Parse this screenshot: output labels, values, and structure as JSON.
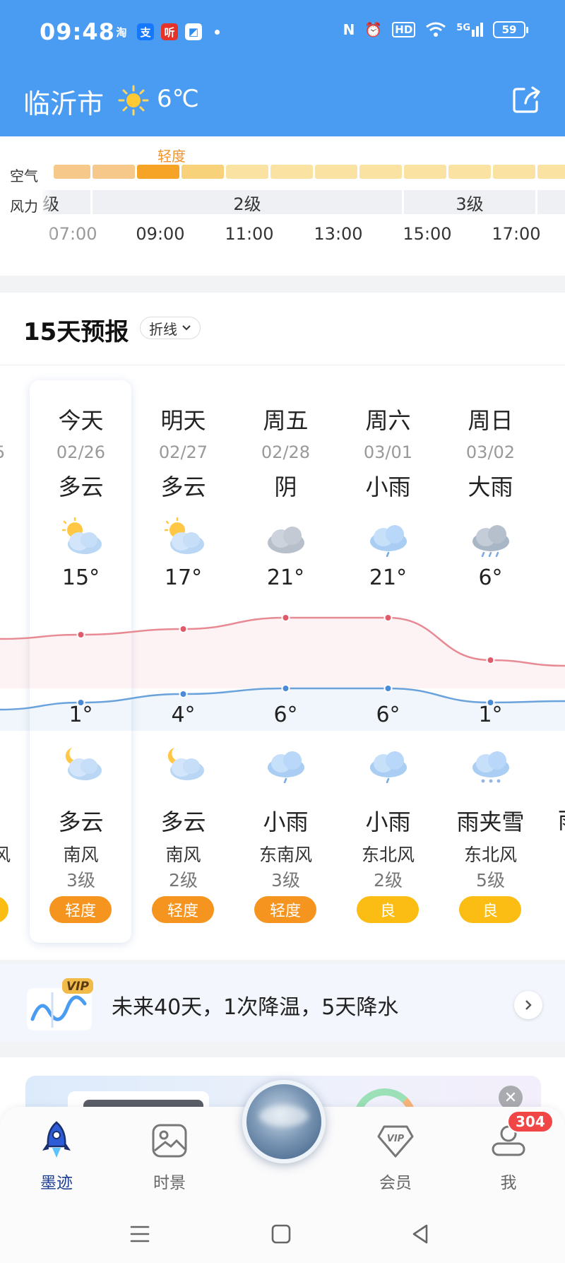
{
  "status_bar": {
    "time": "09:48",
    "app_icons": [
      {
        "name": "taobao-icon",
        "glyph": "淘",
        "bg": "#4a9bf2"
      },
      {
        "name": "alipay-icon",
        "glyph": "支",
        "bg": "#1677ff"
      },
      {
        "name": "ting-icon",
        "glyph": "听",
        "bg": "#e5332a"
      },
      {
        "name": "app-square-icon",
        "glyph": "◩",
        "bg": "#2d8cf0"
      }
    ],
    "nfc": "N",
    "alarm": "⏰",
    "hd": "HD",
    "signal": "5G",
    "battery": "59"
  },
  "header": {
    "city": "临沂市",
    "current_temp": "6℃",
    "weather_icon": "sun-icon"
  },
  "hourly": {
    "aq_label": "空气",
    "wind_label": "风力",
    "aq_highlight": "轻度",
    "wind_segments": [
      "级",
      "2级",
      "3级"
    ],
    "hours": [
      "07:00",
      "09:00",
      "11:00",
      "13:00",
      "15:00",
      "17:00"
    ],
    "colors": {
      "aq_light": "#f7d27a",
      "aq_peach": "#f6c98a",
      "aq_active": "#f5a425",
      "wind_bg": "#eef0f3"
    }
  },
  "forecast": {
    "title": "15天预报",
    "mode": "折线",
    "prev_partial": {
      "date_tail": "5",
      "wind_tail": "风"
    },
    "next_partial": {
      "weather_night": "雨"
    },
    "days": [
      {
        "day": "今天",
        "date": "02/26",
        "weather_day": "多云",
        "icon_day": "partly-cloudy-day-icon",
        "high": "15°",
        "low": "1°",
        "icon_night": "partly-cloudy-night-icon",
        "weather_night": "多云",
        "wind_dir": "南风",
        "wind_level": "3级",
        "aqi": "轻度",
        "aqi_color": "#f5941f",
        "high_val": 15,
        "low_val": 1
      },
      {
        "day": "明天",
        "date": "02/27",
        "weather_day": "多云",
        "icon_day": "partly-cloudy-day-icon",
        "high": "17°",
        "low": "4°",
        "icon_night": "partly-cloudy-night-icon",
        "weather_night": "多云",
        "wind_dir": "南风",
        "wind_level": "2级",
        "aqi": "轻度",
        "aqi_color": "#f5941f",
        "high_val": 17,
        "low_val": 4
      },
      {
        "day": "周五",
        "date": "02/28",
        "weather_day": "阴",
        "icon_day": "overcast-icon",
        "high": "21°",
        "low": "6°",
        "icon_night": "light-rain-icon",
        "weather_night": "小雨",
        "wind_dir": "东南风",
        "wind_level": "3级",
        "aqi": "轻度",
        "aqi_color": "#f5941f",
        "high_val": 21,
        "low_val": 6
      },
      {
        "day": "周六",
        "date": "03/01",
        "weather_day": "小雨",
        "icon_day": "light-rain-icon",
        "high": "21°",
        "low": "6°",
        "icon_night": "light-rain-icon",
        "weather_night": "小雨",
        "wind_dir": "东北风",
        "wind_level": "2级",
        "aqi": "良",
        "aqi_color": "#fbbd13",
        "high_val": 21,
        "low_val": 6
      },
      {
        "day": "周日",
        "date": "03/02",
        "weather_day": "大雨",
        "icon_day": "heavy-rain-icon",
        "high": "6°",
        "low": "1°",
        "icon_night": "sleet-icon",
        "weather_night": "雨夹雪",
        "wind_dir": "东北风",
        "wind_level": "5级",
        "aqi": "良",
        "aqi_color": "#fbbd13",
        "high_val": 6,
        "low_val": 1
      }
    ],
    "colors": {
      "high_line": "#e88a93",
      "low_line": "#6aa3dc",
      "high_dot": "#e05a6a",
      "low_dot": "#4a8ad6"
    }
  },
  "vip_bar": {
    "badge": "VIP",
    "text": "未来40天，1次降温，5天降水"
  },
  "bottom_nav": {
    "items": [
      {
        "label": "墨迹",
        "icon": "rocket-icon",
        "active": true
      },
      {
        "label": "时景",
        "icon": "photo-icon",
        "active": false
      },
      {
        "label": "会员",
        "icon": "vip-diamond-icon",
        "active": false
      },
      {
        "label": "我",
        "icon": "user-icon",
        "active": false
      }
    ],
    "badge_count": "304",
    "ad_close": "✕",
    "vip_mark": "VIP"
  }
}
